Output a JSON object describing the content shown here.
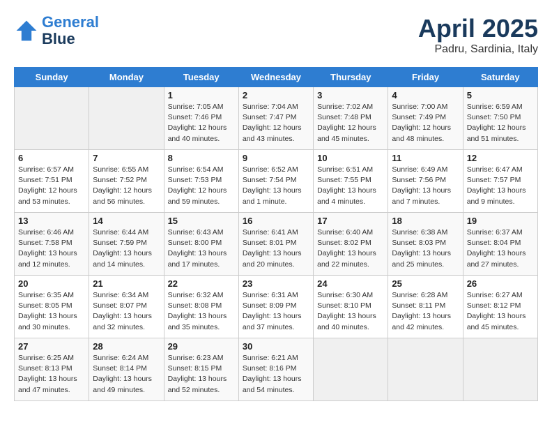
{
  "header": {
    "logo_line1": "General",
    "logo_line2": "Blue",
    "month": "April 2025",
    "location": "Padru, Sardinia, Italy"
  },
  "weekdays": [
    "Sunday",
    "Monday",
    "Tuesday",
    "Wednesday",
    "Thursday",
    "Friday",
    "Saturday"
  ],
  "weeks": [
    [
      {
        "day": "",
        "sunrise": "",
        "sunset": "",
        "daylight": ""
      },
      {
        "day": "",
        "sunrise": "",
        "sunset": "",
        "daylight": ""
      },
      {
        "day": "1",
        "sunrise": "Sunrise: 7:05 AM",
        "sunset": "Sunset: 7:46 PM",
        "daylight": "Daylight: 12 hours and 40 minutes."
      },
      {
        "day": "2",
        "sunrise": "Sunrise: 7:04 AM",
        "sunset": "Sunset: 7:47 PM",
        "daylight": "Daylight: 12 hours and 43 minutes."
      },
      {
        "day": "3",
        "sunrise": "Sunrise: 7:02 AM",
        "sunset": "Sunset: 7:48 PM",
        "daylight": "Daylight: 12 hours and 45 minutes."
      },
      {
        "day": "4",
        "sunrise": "Sunrise: 7:00 AM",
        "sunset": "Sunset: 7:49 PM",
        "daylight": "Daylight: 12 hours and 48 minutes."
      },
      {
        "day": "5",
        "sunrise": "Sunrise: 6:59 AM",
        "sunset": "Sunset: 7:50 PM",
        "daylight": "Daylight: 12 hours and 51 minutes."
      }
    ],
    [
      {
        "day": "6",
        "sunrise": "Sunrise: 6:57 AM",
        "sunset": "Sunset: 7:51 PM",
        "daylight": "Daylight: 12 hours and 53 minutes."
      },
      {
        "day": "7",
        "sunrise": "Sunrise: 6:55 AM",
        "sunset": "Sunset: 7:52 PM",
        "daylight": "Daylight: 12 hours and 56 minutes."
      },
      {
        "day": "8",
        "sunrise": "Sunrise: 6:54 AM",
        "sunset": "Sunset: 7:53 PM",
        "daylight": "Daylight: 12 hours and 59 minutes."
      },
      {
        "day": "9",
        "sunrise": "Sunrise: 6:52 AM",
        "sunset": "Sunset: 7:54 PM",
        "daylight": "Daylight: 13 hours and 1 minute."
      },
      {
        "day": "10",
        "sunrise": "Sunrise: 6:51 AM",
        "sunset": "Sunset: 7:55 PM",
        "daylight": "Daylight: 13 hours and 4 minutes."
      },
      {
        "day": "11",
        "sunrise": "Sunrise: 6:49 AM",
        "sunset": "Sunset: 7:56 PM",
        "daylight": "Daylight: 13 hours and 7 minutes."
      },
      {
        "day": "12",
        "sunrise": "Sunrise: 6:47 AM",
        "sunset": "Sunset: 7:57 PM",
        "daylight": "Daylight: 13 hours and 9 minutes."
      }
    ],
    [
      {
        "day": "13",
        "sunrise": "Sunrise: 6:46 AM",
        "sunset": "Sunset: 7:58 PM",
        "daylight": "Daylight: 13 hours and 12 minutes."
      },
      {
        "day": "14",
        "sunrise": "Sunrise: 6:44 AM",
        "sunset": "Sunset: 7:59 PM",
        "daylight": "Daylight: 13 hours and 14 minutes."
      },
      {
        "day": "15",
        "sunrise": "Sunrise: 6:43 AM",
        "sunset": "Sunset: 8:00 PM",
        "daylight": "Daylight: 13 hours and 17 minutes."
      },
      {
        "day": "16",
        "sunrise": "Sunrise: 6:41 AM",
        "sunset": "Sunset: 8:01 PM",
        "daylight": "Daylight: 13 hours and 20 minutes."
      },
      {
        "day": "17",
        "sunrise": "Sunrise: 6:40 AM",
        "sunset": "Sunset: 8:02 PM",
        "daylight": "Daylight: 13 hours and 22 minutes."
      },
      {
        "day": "18",
        "sunrise": "Sunrise: 6:38 AM",
        "sunset": "Sunset: 8:03 PM",
        "daylight": "Daylight: 13 hours and 25 minutes."
      },
      {
        "day": "19",
        "sunrise": "Sunrise: 6:37 AM",
        "sunset": "Sunset: 8:04 PM",
        "daylight": "Daylight: 13 hours and 27 minutes."
      }
    ],
    [
      {
        "day": "20",
        "sunrise": "Sunrise: 6:35 AM",
        "sunset": "Sunset: 8:05 PM",
        "daylight": "Daylight: 13 hours and 30 minutes."
      },
      {
        "day": "21",
        "sunrise": "Sunrise: 6:34 AM",
        "sunset": "Sunset: 8:07 PM",
        "daylight": "Daylight: 13 hours and 32 minutes."
      },
      {
        "day": "22",
        "sunrise": "Sunrise: 6:32 AM",
        "sunset": "Sunset: 8:08 PM",
        "daylight": "Daylight: 13 hours and 35 minutes."
      },
      {
        "day": "23",
        "sunrise": "Sunrise: 6:31 AM",
        "sunset": "Sunset: 8:09 PM",
        "daylight": "Daylight: 13 hours and 37 minutes."
      },
      {
        "day": "24",
        "sunrise": "Sunrise: 6:30 AM",
        "sunset": "Sunset: 8:10 PM",
        "daylight": "Daylight: 13 hours and 40 minutes."
      },
      {
        "day": "25",
        "sunrise": "Sunrise: 6:28 AM",
        "sunset": "Sunset: 8:11 PM",
        "daylight": "Daylight: 13 hours and 42 minutes."
      },
      {
        "day": "26",
        "sunrise": "Sunrise: 6:27 AM",
        "sunset": "Sunset: 8:12 PM",
        "daylight": "Daylight: 13 hours and 45 minutes."
      }
    ],
    [
      {
        "day": "27",
        "sunrise": "Sunrise: 6:25 AM",
        "sunset": "Sunset: 8:13 PM",
        "daylight": "Daylight: 13 hours and 47 minutes."
      },
      {
        "day": "28",
        "sunrise": "Sunrise: 6:24 AM",
        "sunset": "Sunset: 8:14 PM",
        "daylight": "Daylight: 13 hours and 49 minutes."
      },
      {
        "day": "29",
        "sunrise": "Sunrise: 6:23 AM",
        "sunset": "Sunset: 8:15 PM",
        "daylight": "Daylight: 13 hours and 52 minutes."
      },
      {
        "day": "30",
        "sunrise": "Sunrise: 6:21 AM",
        "sunset": "Sunset: 8:16 PM",
        "daylight": "Daylight: 13 hours and 54 minutes."
      },
      {
        "day": "",
        "sunrise": "",
        "sunset": "",
        "daylight": ""
      },
      {
        "day": "",
        "sunrise": "",
        "sunset": "",
        "daylight": ""
      },
      {
        "day": "",
        "sunrise": "",
        "sunset": "",
        "daylight": ""
      }
    ]
  ]
}
